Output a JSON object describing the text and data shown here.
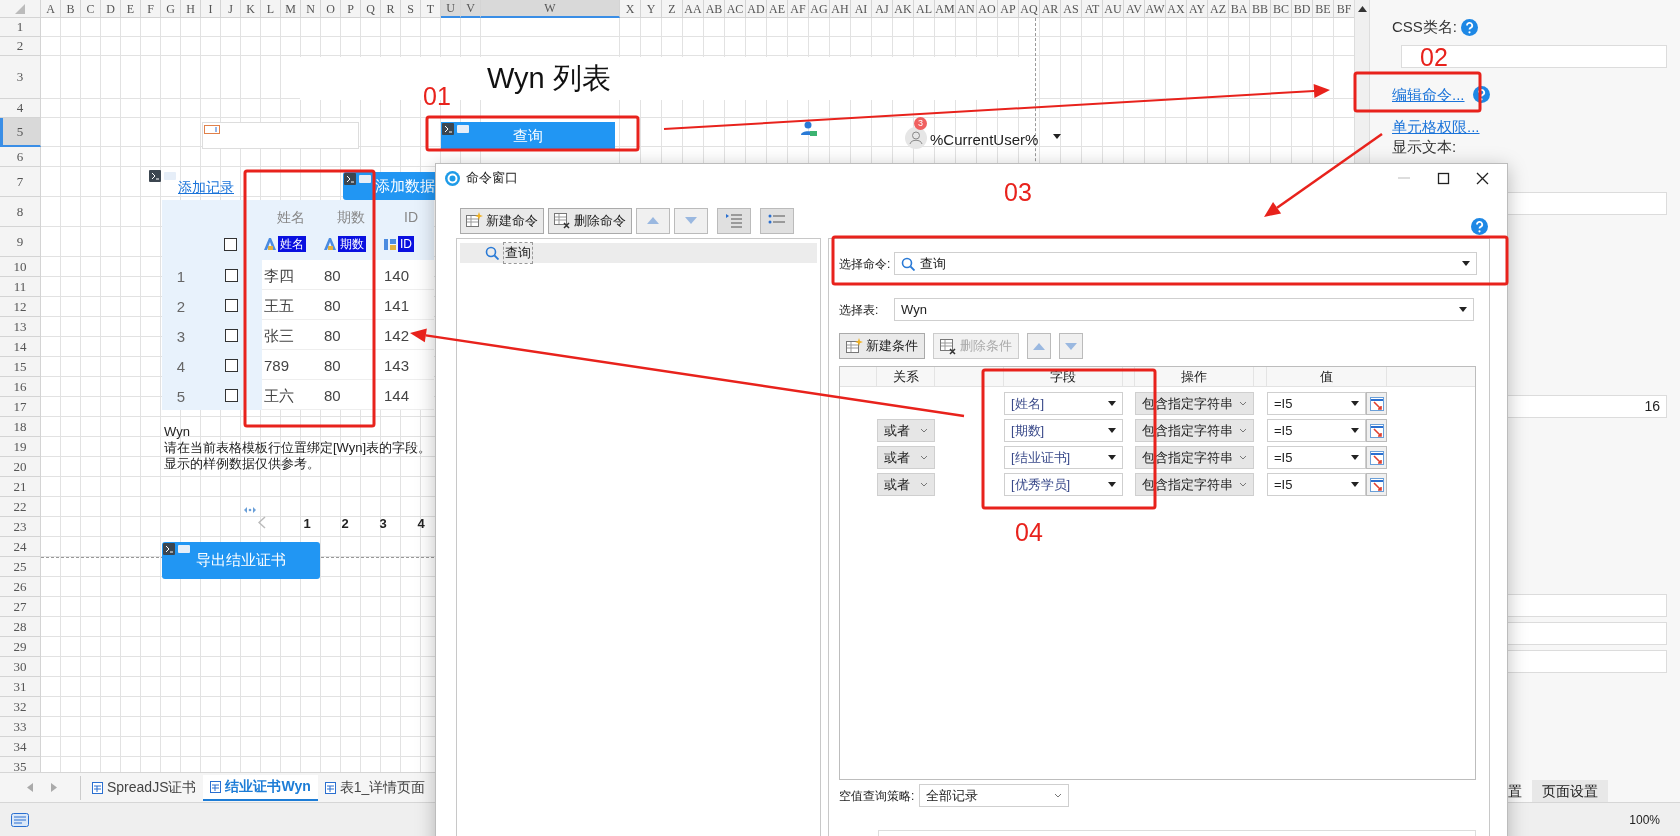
{
  "sheet": {
    "columns": [
      {
        "label": "A",
        "selected": false
      },
      {
        "label": "B",
        "selected": false
      },
      {
        "label": "C",
        "selected": false
      },
      {
        "label": "D",
        "selected": false
      },
      {
        "label": "E",
        "selected": false
      },
      {
        "label": "F",
        "selected": false
      },
      {
        "label": "G",
        "selected": false
      },
      {
        "label": "H",
        "selected": false
      },
      {
        "label": "I",
        "selected": false
      },
      {
        "label": "J",
        "selected": false
      },
      {
        "label": "K",
        "selected": false
      },
      {
        "label": "L",
        "selected": false
      },
      {
        "label": "M",
        "selected": false
      },
      {
        "label": "N",
        "selected": false
      },
      {
        "label": "O",
        "selected": false
      },
      {
        "label": "P",
        "selected": false
      },
      {
        "label": "Q",
        "selected": false
      },
      {
        "label": "R",
        "selected": false
      },
      {
        "label": "S",
        "selected": false
      },
      {
        "label": "T",
        "selected": false
      },
      {
        "label": "U",
        "selected": true
      },
      {
        "label": "V",
        "selected": true
      },
      {
        "label": "W",
        "selected": true
      },
      {
        "label": "X",
        "selected": false
      },
      {
        "label": "Y",
        "selected": false
      },
      {
        "label": "Z",
        "selected": false
      },
      {
        "label": "AA",
        "selected": false
      },
      {
        "label": "AB",
        "selected": false
      },
      {
        "label": "AC",
        "selected": false
      },
      {
        "label": "AD",
        "selected": false
      },
      {
        "label": "AE",
        "selected": false
      },
      {
        "label": "AF",
        "selected": false
      },
      {
        "label": "AG",
        "selected": false
      },
      {
        "label": "AH",
        "selected": false
      },
      {
        "label": "AI",
        "selected": false
      },
      {
        "label": "AJ",
        "selected": false
      },
      {
        "label": "AK",
        "selected": false
      },
      {
        "label": "AL",
        "selected": false
      },
      {
        "label": "AM",
        "selected": false
      },
      {
        "label": "AN",
        "selected": false
      },
      {
        "label": "AO",
        "selected": false
      },
      {
        "label": "AP",
        "selected": false
      },
      {
        "label": "AQ",
        "selected": false
      },
      {
        "label": "AR",
        "selected": false
      },
      {
        "label": "AS",
        "selected": false
      },
      {
        "label": "AT",
        "selected": false
      },
      {
        "label": "AU",
        "selected": false
      },
      {
        "label": "AV",
        "selected": false
      },
      {
        "label": "AW",
        "selected": false
      },
      {
        "label": "AX",
        "selected": false
      },
      {
        "label": "AY",
        "selected": false
      },
      {
        "label": "AZ",
        "selected": false
      },
      {
        "label": "BA",
        "selected": false
      },
      {
        "label": "BB",
        "selected": false
      },
      {
        "label": "BC",
        "selected": false
      },
      {
        "label": "BD",
        "selected": false
      },
      {
        "label": "BE",
        "selected": false
      },
      {
        "label": "BF",
        "selected": false
      }
    ],
    "rows": [
      {
        "label": "1",
        "selected": false
      },
      {
        "label": "2",
        "selected": false
      },
      {
        "label": "3",
        "selected": false
      },
      {
        "label": "4",
        "selected": false
      },
      {
        "label": "5",
        "selected": true
      },
      {
        "label": "6",
        "selected": false
      },
      {
        "label": "7",
        "selected": false
      },
      {
        "label": "8",
        "selected": false
      },
      {
        "label": "9",
        "selected": false
      },
      {
        "label": "10",
        "selected": false
      },
      {
        "label": "11",
        "selected": false
      },
      {
        "label": "12",
        "selected": false
      },
      {
        "label": "13",
        "selected": false
      },
      {
        "label": "14",
        "selected": false
      },
      {
        "label": "15",
        "selected": false
      },
      {
        "label": "16",
        "selected": false
      },
      {
        "label": "17",
        "selected": false
      },
      {
        "label": "18",
        "selected": false
      },
      {
        "label": "19",
        "selected": false
      },
      {
        "label": "20",
        "selected": false
      },
      {
        "label": "21",
        "selected": false
      },
      {
        "label": "22",
        "selected": false
      },
      {
        "label": "23",
        "selected": false
      },
      {
        "label": "24",
        "selected": false
      },
      {
        "label": "25",
        "selected": false
      },
      {
        "label": "26",
        "selected": false
      },
      {
        "label": "27",
        "selected": false
      },
      {
        "label": "28",
        "selected": false
      },
      {
        "label": "29",
        "selected": false
      },
      {
        "label": "30",
        "selected": false
      },
      {
        "label": "31",
        "selected": false
      },
      {
        "label": "32",
        "selected": false
      },
      {
        "label": "33",
        "selected": false
      },
      {
        "label": "34",
        "selected": false
      },
      {
        "label": "35",
        "selected": false
      }
    ],
    "title": "Wyn 列表",
    "query_button": "查询",
    "user_widget": {
      "badge": "3",
      "text": "%CurrentUser%"
    },
    "add_record_link": "添加记录",
    "add_data_button": "添加数据",
    "list": {
      "headers": [
        "姓名",
        "期数",
        "ID"
      ],
      "select_all_checked": false,
      "field_badges": [
        {
          "kind": "text",
          "label": "姓名"
        },
        {
          "kind": "text",
          "label": "期数"
        },
        {
          "kind": "number",
          "label": "ID"
        }
      ],
      "rows": [
        {
          "number": "1",
          "checked": false,
          "cells": [
            "李四",
            "80",
            "140"
          ]
        },
        {
          "number": "2",
          "checked": false,
          "cells": [
            "王五",
            "80",
            "141"
          ]
        },
        {
          "number": "3",
          "checked": false,
          "cells": [
            "张三",
            "80",
            "142"
          ]
        },
        {
          "number": "4",
          "checked": false,
          "cells": [
            "789",
            "80",
            "143"
          ]
        },
        {
          "number": "5",
          "checked": false,
          "cells": [
            "王六",
            "80",
            "144"
          ]
        }
      ]
    },
    "note": {
      "title": "Wyn",
      "lines": [
        "请在当前表格模板行位置绑定[Wyn]表的字段。",
        "显示的样例数据仅供参考。"
      ]
    },
    "pager": {
      "pages": [
        "1",
        "2",
        "3",
        "4"
      ]
    },
    "export_button": "导出结业证书"
  },
  "sheet_tabs": [
    {
      "label": "SpreadJS证书",
      "selected": false
    },
    {
      "label": "结业证书Wyn",
      "selected": true
    },
    {
      "label": "表1_详情页面",
      "selected": false
    }
  ],
  "properties": {
    "css_class_label": "CSS类名:",
    "edit_command_link": "编辑命令...",
    "cell_permission_link": "单元格权限...",
    "display_text_label": "显示文本:",
    "number_value": "16",
    "tabs": [
      {
        "label": "置",
        "selected": true
      },
      {
        "label": "页面设置",
        "selected": false
      }
    ]
  },
  "status_bar": {
    "zoom": "100%"
  },
  "dialog": {
    "title": "命令窗口",
    "toolbar": [
      "新建命令",
      "删除命令"
    ],
    "commands": [
      {
        "label": "查询",
        "selected": true
      }
    ],
    "select_command_label": "选择命令:",
    "select_command_value": "查询",
    "select_table_label": "选择表:",
    "select_table_value": "Wyn",
    "condition_buttons": [
      {
        "label": "新建条件",
        "disabled": false
      },
      {
        "label": "删除条件",
        "disabled": true
      }
    ],
    "grid_headers": [
      "关系",
      "字段",
      "操作",
      "值"
    ],
    "conditions": [
      {
        "field": "[姓名]",
        "operation": "包含指定字符串",
        "value": "=I5"
      },
      {
        "relation": "或者",
        "field": "[期数]",
        "operation": "包含指定字符串",
        "value": "=I5"
      },
      {
        "relation": "或者",
        "field": "[结业证书]",
        "operation": "包含指定字符串",
        "value": "=I5"
      },
      {
        "relation": "或者",
        "field": "[优秀学员]",
        "operation": "包含指定字符串",
        "value": "=I5"
      }
    ],
    "null_policy_label": "空值查询策略:",
    "null_policy_value": "全部记录"
  },
  "annotations": [
    {
      "label": "01"
    },
    {
      "label": "02"
    },
    {
      "label": "03"
    },
    {
      "label": "04"
    }
  ]
}
